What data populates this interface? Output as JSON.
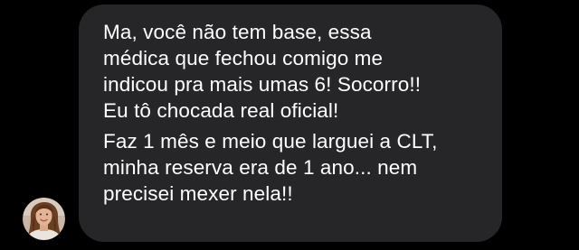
{
  "message": {
    "paragraphs": [
      {
        "lines": [
          "Ma, você não tem base, essa",
          "médica que fechou comigo me",
          "indicou pra mais umas 6! Socorro!!",
          "Eu tô chocada real oficial!"
        ]
      },
      {
        "lines": [
          "Faz 1 mês e meio que larguei a CLT,",
          "minha reserva era de 1 ano... nem",
          "precisei mexer nela!!"
        ]
      }
    ]
  },
  "sender": {
    "avatar_icon": "user-avatar-photo"
  },
  "colors": {
    "background": "#000000",
    "bubble": "#262629",
    "text": "#ffffff"
  }
}
